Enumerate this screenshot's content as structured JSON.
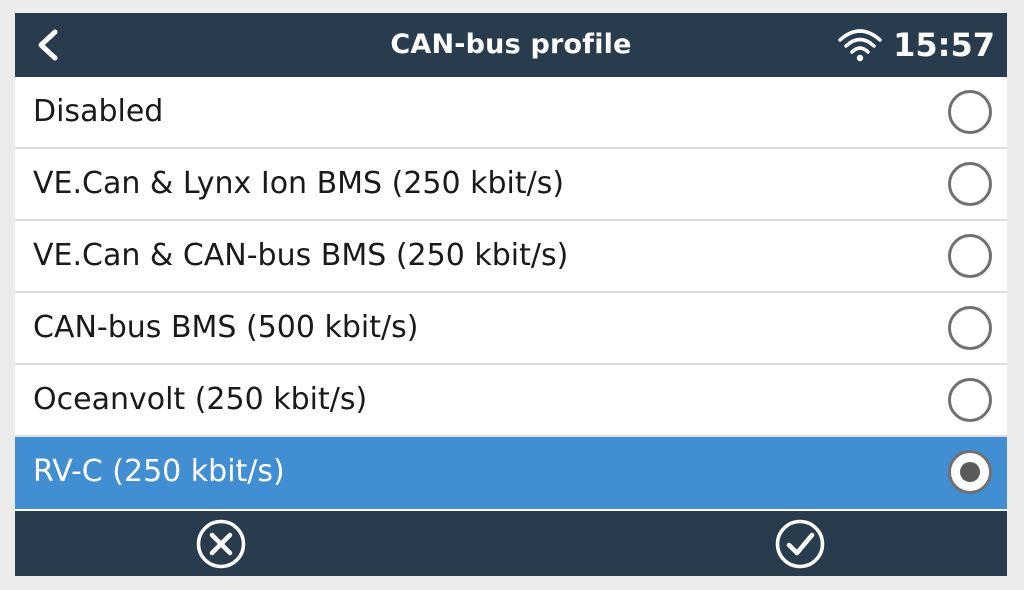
{
  "header": {
    "title": "CAN-bus profile",
    "clock": "15:57",
    "back_icon": "chevron-left-icon",
    "wifi_icon": "wifi-icon"
  },
  "profiles": [
    {
      "label": "Disabled",
      "selected": false
    },
    {
      "label": "VE.Can & Lynx Ion BMS (250 kbit/s)",
      "selected": false
    },
    {
      "label": "VE.Can & CAN-bus BMS (250 kbit/s)",
      "selected": false
    },
    {
      "label": "CAN-bus BMS (500 kbit/s)",
      "selected": false
    },
    {
      "label": "Oceanvolt (250 kbit/s)",
      "selected": false
    },
    {
      "label": "RV-C (250 kbit/s)",
      "selected": true
    }
  ],
  "footer": {
    "cancel_icon": "cancel-icon",
    "confirm_icon": "check-icon"
  },
  "colors": {
    "header_bg": "#283c4e",
    "selected_bg": "#418fd2",
    "radio_ring": "#707070",
    "text": "#1a1a1a"
  }
}
